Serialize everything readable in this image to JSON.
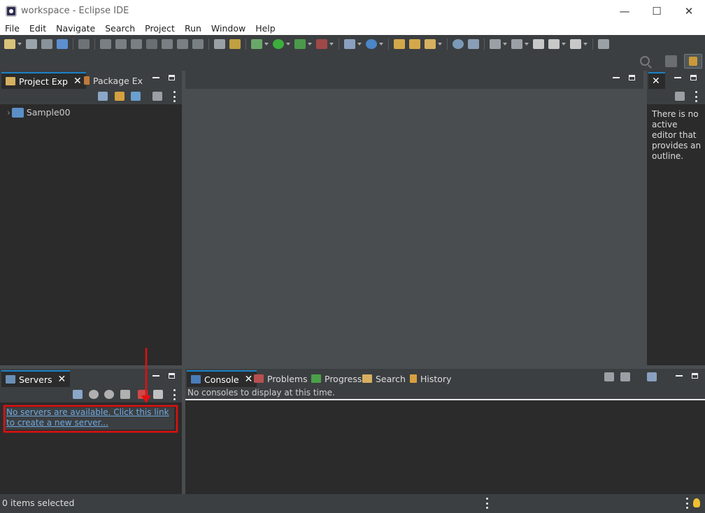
{
  "window": {
    "title": "workspace - Eclipse IDE",
    "minimize": "—",
    "maximize": "☐",
    "close": "✕"
  },
  "menu": [
    "File",
    "Edit",
    "Navigate",
    "Search",
    "Project",
    "Run",
    "Window",
    "Help"
  ],
  "left_top_panel": {
    "tabs": [
      {
        "label": "Project Exp",
        "active": true,
        "icon": "project-explorer-icon"
      },
      {
        "label": "Package Ex",
        "active": false,
        "icon": "package-explorer-icon"
      }
    ],
    "tree": [
      {
        "label": "Sample00",
        "icon": "project-folder-icon",
        "expand": "›"
      }
    ]
  },
  "outline_panel": {
    "message": "There is no active editor that provides an outline."
  },
  "servers_panel": {
    "tab_label": "Servers",
    "link_text": "No servers are available. Click this link to create a new server..."
  },
  "console_panel": {
    "tabs": [
      {
        "label": "Console",
        "active": true,
        "icon": "console-icon"
      },
      {
        "label": "Problems",
        "active": false,
        "icon": "problems-icon"
      },
      {
        "label": "Progress",
        "active": false,
        "icon": "progress-icon"
      },
      {
        "label": "Search",
        "active": false,
        "icon": "search-tab-icon"
      },
      {
        "label": "History",
        "active": false,
        "icon": "history-icon"
      }
    ],
    "message": "No consoles to display at this time."
  },
  "status": {
    "text": "0 items selected"
  },
  "colors": {
    "accent": "#1a82c7",
    "annotation": "#e01010",
    "link": "#6ea9e0"
  }
}
